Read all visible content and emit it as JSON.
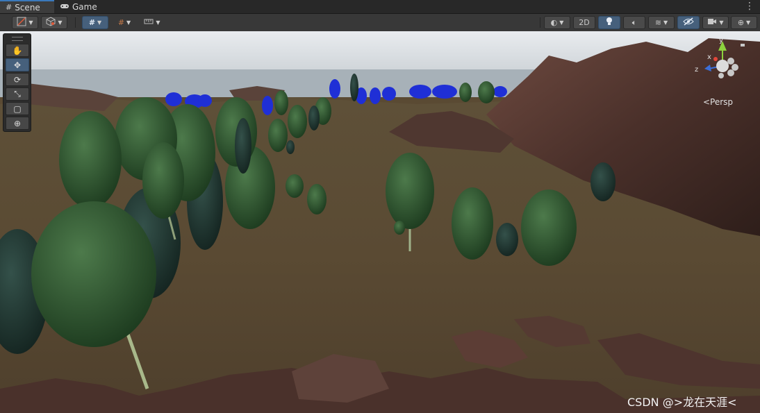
{
  "tabs": [
    {
      "label": "Scene",
      "icon": "grid-icon",
      "active": true
    },
    {
      "label": "Game",
      "icon": "gamepad-icon",
      "active": false
    }
  ],
  "toolbar": {
    "btn_2d": "2D"
  },
  "tools": [
    {
      "name": "view-tool",
      "glyph": "✋"
    },
    {
      "name": "move-tool",
      "glyph": "✥"
    },
    {
      "name": "rotate-tool",
      "glyph": "⟳"
    },
    {
      "name": "scale-tool",
      "glyph": "⤡"
    },
    {
      "name": "rect-tool",
      "glyph": "▢"
    },
    {
      "name": "transform-tool",
      "glyph": "⊕"
    }
  ],
  "gizmo": {
    "y_label": "y",
    "x_label": "x",
    "z_label": "z",
    "projection": "<Persp",
    "colors": {
      "x": "#e2463a",
      "y": "#8cd13e",
      "z": "#3c6fd8"
    }
  },
  "watermark": "CSDN @>龙在天涯<",
  "colors": {
    "accent": "#46607c",
    "tab_underline": "#3a79bb"
  }
}
